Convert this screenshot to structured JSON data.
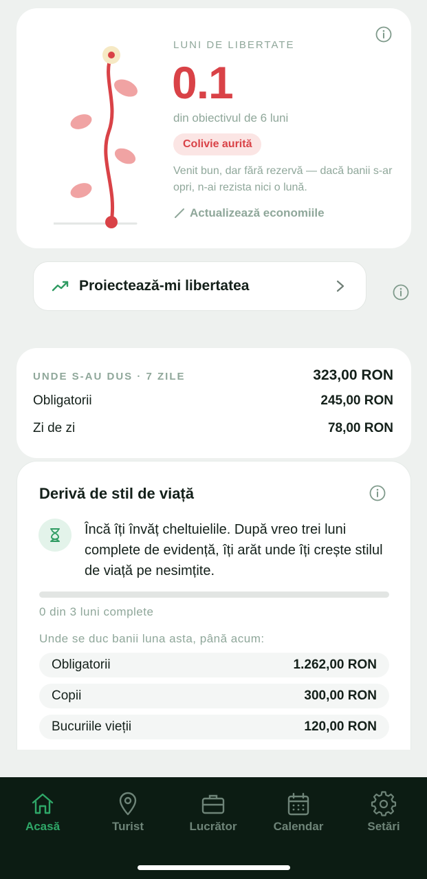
{
  "hero": {
    "eyebrow": "LUNI DE LIBERTATE",
    "value": "0.1",
    "goal": "din obiectivul de 6 luni",
    "badge": "Colivie aurită",
    "description": "Venit bun, dar fără rezervă — dacă banii s-ar opri, n-ai rezista nici o lună.",
    "update_label": "Actualizează economiile",
    "progress_fraction": 0.0167
  },
  "project_button": {
    "label": "Proiectează-mi libertatea"
  },
  "spending": {
    "eyebrow": "UNDE S-AU DUS · 7 ZILE",
    "total": "323,00 RON",
    "rows": [
      {
        "label": "Obligatorii",
        "value": "245,00 RON"
      },
      {
        "label": "Zi de zi",
        "value": "78,00 RON"
      }
    ]
  },
  "drift": {
    "title": "Derivă de stil de viață",
    "message": "Încă îți învăț cheltuielile. După vreo trei luni complete de evidență, îți arăt unde îți crește stilul de viață pe nesimțite.",
    "progress_fraction": 0,
    "progress_label": "0 din 3 luni complete",
    "where_label": "Unde se duc banii luna asta, până acum:",
    "categories": [
      {
        "label": "Obligatorii",
        "value": "1.262,00 RON"
      },
      {
        "label": "Copii",
        "value": "300,00 RON"
      },
      {
        "label": "Bucuriile vieții",
        "value": "120,00 RON"
      }
    ]
  },
  "tabs": [
    {
      "label": "Acasă",
      "icon": "home-icon",
      "active": true
    },
    {
      "label": "Turist",
      "icon": "map-pin-icon",
      "active": false
    },
    {
      "label": "Lucrător",
      "icon": "briefcase-icon",
      "active": false
    },
    {
      "label": "Calendar",
      "icon": "calendar-icon",
      "active": false
    },
    {
      "label": "Setări",
      "icon": "gear-icon",
      "active": false
    }
  ],
  "colors": {
    "accent_red": "#d94247",
    "accent_green": "#2fa868",
    "muted_text": "#8fa79a",
    "tabbar_bg": "#0c1c13"
  }
}
